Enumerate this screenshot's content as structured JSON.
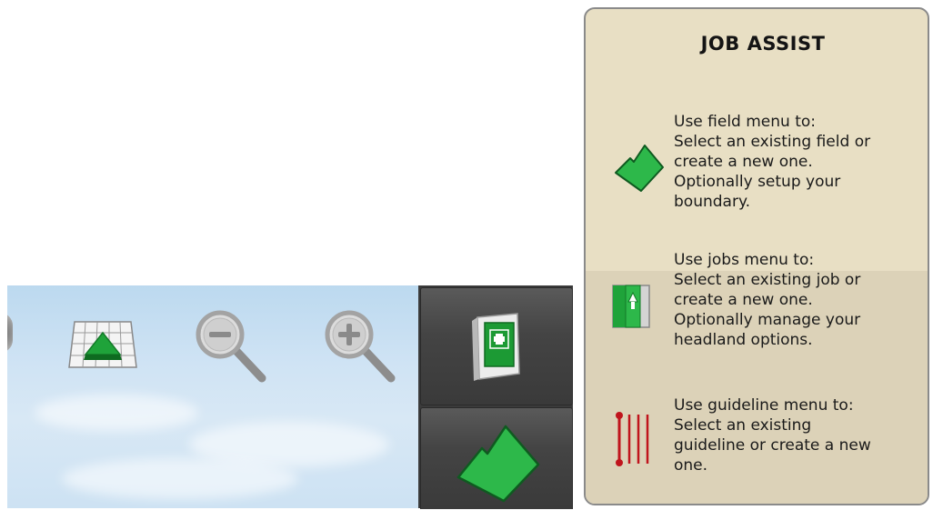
{
  "map_toolbar": {
    "buttons": [
      {
        "name": "map-view-toggle-button",
        "icon": "grid-field-icon"
      },
      {
        "name": "zoom-out-button",
        "icon": "zoom-out-icon"
      },
      {
        "name": "zoom-in-button",
        "icon": "zoom-in-icon"
      }
    ]
  },
  "sidebar": {
    "buttons": [
      {
        "name": "jobs-menu-button",
        "icon": "jobs-book-icon"
      },
      {
        "name": "field-menu-button",
        "icon": "field-icon"
      }
    ]
  },
  "job_assist": {
    "title": "JOB ASSIST",
    "items": [
      {
        "icon": "field-icon",
        "lines": [
          "Use field menu to:",
          "Select an existing field or",
          "create a new one.",
          "Optionally setup your",
          "boundary."
        ]
      },
      {
        "icon": "jobs-icon",
        "lines": [
          "Use jobs menu to:",
          "Select an existing job or",
          "create a new one.",
          "Optionally manage your",
          "headland options."
        ]
      },
      {
        "icon": "guideline-icon",
        "lines": [
          "Use guideline menu to:",
          "Select an existing",
          "guideline or create a new",
          "one."
        ]
      }
    ]
  },
  "colors": {
    "field_green": "#2db84a",
    "panel_bg": "#e8dfc4",
    "sidebar_bg": "#3b3b3b",
    "guideline_red": "#c0141c"
  }
}
